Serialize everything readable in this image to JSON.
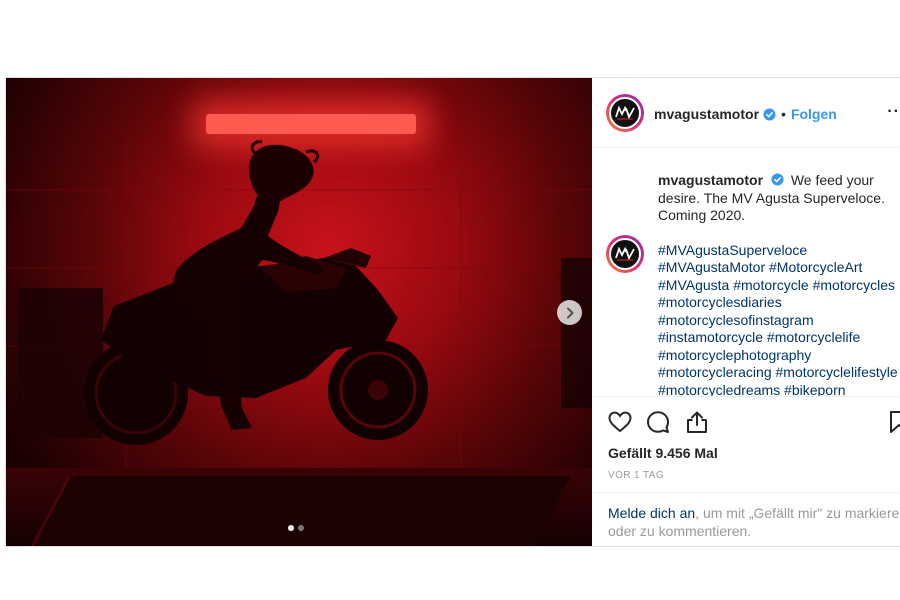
{
  "post": {
    "username": "mvagustamotor",
    "follow_label": "Folgen",
    "separator": "•",
    "more_label": "··",
    "caption": {
      "username": "mvagustamotor",
      "text": "We feed your desire. The MV Agusta Superveloce. Coming 2020.",
      "hashtags": [
        "#MVAgustaSuperveloce",
        "#MVAgustaMotor #MotorcycleArt",
        "#MVAgusta #motorcycle #motorcycles",
        "#motorcyclesdiaries",
        "#motorcyclesofinstagram",
        "#instamotorcycle #motorcyclelife",
        "#motorcyclephotography",
        "#motorcycleracing #motorcyclelifestyle",
        "#motorcycledreams #bikeporn"
      ]
    },
    "likes": "Gefällt 9.456 Mal",
    "time": "VOR 1 TAG",
    "login": {
      "link": "Melde dich an",
      "line1_rest": ", um mit „Gefällt mir\" zu markieren",
      "line2": "oder zu kommentieren."
    },
    "carousel": {
      "current": 1,
      "total": 2
    }
  },
  "icons": {
    "verified": "verified-badge-icon",
    "like": "heart-icon",
    "comment": "comment-icon",
    "share": "share-icon",
    "save": "bookmark-icon",
    "next": "chevron-right-icon",
    "avatar": "mv-agusta-logo"
  },
  "colors": {
    "link": "#003569",
    "follow": "#3897f0",
    "verified": "#3897f0",
    "muted": "#999999",
    "photo_red": "#c8121a"
  }
}
